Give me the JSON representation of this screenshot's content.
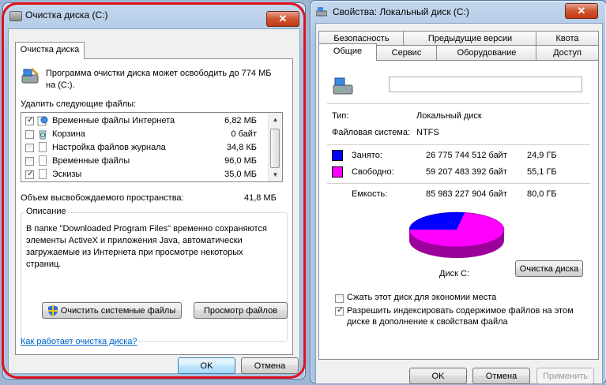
{
  "colors": {
    "used": "#0000ff",
    "free": "#ff00ff",
    "highlight_ring": "#e0121c"
  },
  "left_window": {
    "title": "Очистка диска  (C:)",
    "close_label": "✕",
    "tab_label": "Очистка диска",
    "intro_text_line1": "Программа очистки диска может освободить до 774 МБ",
    "intro_text_line2": "на  (C:).",
    "files_label": "Удалить следующие файлы:",
    "files": [
      {
        "name": "Временные файлы Интернета",
        "size": "6,82 МБ",
        "checked": true,
        "icon": "internet-files-icon"
      },
      {
        "name": "Корзина",
        "size": "0 байт",
        "checked": false,
        "icon": "recycle-bin-icon"
      },
      {
        "name": "Настройка файлов журнала",
        "size": "34,8 КБ",
        "checked": false,
        "icon": "file-icon"
      },
      {
        "name": "Временные файлы",
        "size": "96,0 МБ",
        "checked": false,
        "icon": "file-icon"
      },
      {
        "name": "Эскизы",
        "size": "35,0 МБ",
        "checked": true,
        "icon": "file-icon"
      }
    ],
    "freed_label": "Объем высвобождаемого пространства:",
    "freed_value": "41,8 МБ",
    "description_title": "Описание",
    "description_lines": [
      "В папке \"Downloaded Program Files\" временно сохраняются",
      "элементы ActiveX и приложения Java, автоматически",
      "загружаемые из Интернета при просмотре некоторых",
      "страниц."
    ],
    "clean_system_label": "Очистить системные файлы",
    "view_files_label": "Просмотр файлов",
    "help_link": "Как работает очистка диска?",
    "ok_label": "OK",
    "cancel_label": "Отмена"
  },
  "right_window": {
    "title": "Свойства: Локальный диск (C:)",
    "close_label": "✕",
    "tabs_top": [
      "Безопасность",
      "Предыдущие версии",
      "Квота"
    ],
    "tabs_bottom": [
      "Общие",
      "Сервис",
      "Оборудование",
      "Доступ"
    ],
    "active_tab": "Общие",
    "name_value": "",
    "type_label": "Тип:",
    "type_value": "Локальный диск",
    "fs_label": "Файловая система:",
    "fs_value": "NTFS",
    "used_label": "Занято:",
    "used_bytes": "26 775 744 512 байт",
    "used_gb": "24,9 ГБ",
    "free_label": "Свободно:",
    "free_bytes": "59 207 483 392 байт",
    "free_gb": "55,1 ГБ",
    "capacity_label": "Емкость:",
    "capacity_bytes": "85 983 227 904 байт",
    "capacity_gb": "80,0 ГБ",
    "disk_label": "Диск C:",
    "cleanup_label": "Очистка диска",
    "compress_label": "Сжать этот диск для экономии места",
    "compress_checked": false,
    "index_label_line1": "Разрешить индексировать содержимое файлов на этом",
    "index_label_line2": "диске в дополнение к свойствам файла",
    "index_checked": true,
    "ok_label": "OK",
    "cancel_label": "Отмена",
    "apply_label": "Применить"
  }
}
